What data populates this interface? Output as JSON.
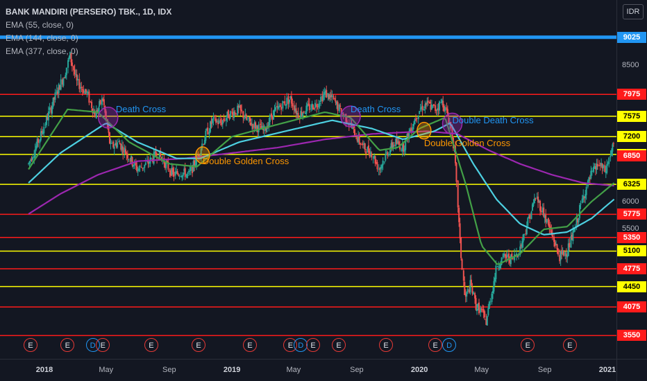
{
  "legend": {
    "title": "BANK MANDIRI (PERSERO) TBK., 1D, IDX",
    "ema": [
      "EMA (55, close, 0)",
      "EMA (144, close, 0)",
      "EMA (377, close, 0)"
    ]
  },
  "currency": "IDR",
  "chart_data": {
    "type": "candlestick",
    "yrange": [
      3450,
      9150
    ],
    "y_ticks": [
      "8500",
      "6000",
      "5500"
    ],
    "x_ticks": [
      {
        "label": "2018",
        "bold": true
      },
      {
        "label": "May",
        "bold": false
      },
      {
        "label": "Sep",
        "bold": false
      },
      {
        "label": "2019",
        "bold": true
      },
      {
        "label": "May",
        "bold": false
      },
      {
        "label": "Sep",
        "bold": false
      },
      {
        "label": "2020",
        "bold": true
      },
      {
        "label": "May",
        "bold": false
      },
      {
        "label": "Sep",
        "bold": false
      },
      {
        "label": "2021",
        "bold": true
      }
    ],
    "horizontal_levels": [
      {
        "label": "9025",
        "value": 9025,
        "color": "#2196f3",
        "text_color": "#ffffff",
        "thick": true
      },
      {
        "label": "7975",
        "value": 7975,
        "color": "#ff1b1b",
        "text_color": "#ffffff"
      },
      {
        "label": "7575",
        "value": 7575,
        "color": "#ffff00",
        "text_color": "#000000"
      },
      {
        "label": "7200",
        "value": 7200,
        "color": "#ffff00",
        "text_color": "#000000"
      },
      {
        "label": "6875",
        "value": 6875,
        "color": "#ffff00",
        "text_color": "#000000"
      },
      {
        "label": "6850",
        "value": 6850,
        "color": "#ff1b1b",
        "text_color": "#ffffff",
        "label_only": true
      },
      {
        "label": "6325",
        "value": 6325,
        "color": "#ffff00",
        "text_color": "#000000"
      },
      {
        "label": "5775",
        "value": 5775,
        "color": "#ff1b1b",
        "text_color": "#ffffff"
      },
      {
        "label": "5350",
        "value": 5350,
        "color": "#ff1b1b",
        "text_color": "#ffffff"
      },
      {
        "label": "5100",
        "value": 5100,
        "color": "#ffff00",
        "text_color": "#000000"
      },
      {
        "label": "4775",
        "value": 4775,
        "color": "#ff1b1b",
        "text_color": "#ffffff"
      },
      {
        "label": "4450",
        "value": 4450,
        "color": "#ffff00",
        "text_color": "#000000"
      },
      {
        "label": "4075",
        "value": 4075,
        "color": "#ff1b1b",
        "text_color": "#ffffff"
      },
      {
        "label": "3550",
        "value": 3550,
        "color": "#ff1b1b",
        "text_color": "#ffffff"
      }
    ],
    "price_path": [
      [
        "2017-12-01",
        6700
      ],
      [
        "2017-12-20",
        7100
      ],
      [
        "2018-01-05",
        7500
      ],
      [
        "2018-01-25",
        8000
      ],
      [
        "2018-02-10",
        8350
      ],
      [
        "2018-02-20",
        8700
      ],
      [
        "2018-03-05",
        8200
      ],
      [
        "2018-03-25",
        8000
      ],
      [
        "2018-04-10",
        7600
      ],
      [
        "2018-04-25",
        7900
      ],
      [
        "2018-05-10",
        7000
      ],
      [
        "2018-05-25",
        7100
      ],
      [
        "2018-06-10",
        6900
      ],
      [
        "2018-07-01",
        6600
      ],
      [
        "2018-07-20",
        6700
      ],
      [
        "2018-08-10",
        6900
      ],
      [
        "2018-08-25",
        6700
      ],
      [
        "2018-09-10",
        6500
      ],
      [
        "2018-09-25",
        6550
      ],
      [
        "2018-10-10",
        6500
      ],
      [
        "2018-10-25",
        6800
      ],
      [
        "2018-11-10",
        7200
      ],
      [
        "2018-11-25",
        7500
      ],
      [
        "2018-12-10",
        7450
      ],
      [
        "2018-12-25",
        7600
      ],
      [
        "2019-01-15",
        7700
      ],
      [
        "2019-01-30",
        7500
      ],
      [
        "2019-02-15",
        7400
      ],
      [
        "2019-03-05",
        7300
      ],
      [
        "2019-03-20",
        7600
      ],
      [
        "2019-04-10",
        7800
      ],
      [
        "2019-04-25",
        7900
      ],
      [
        "2019-05-10",
        7600
      ],
      [
        "2019-05-25",
        7700
      ],
      [
        "2019-06-15",
        7800
      ],
      [
        "2019-07-01",
        8000
      ],
      [
        "2019-07-15",
        7900
      ],
      [
        "2019-07-30",
        7700
      ],
      [
        "2019-08-15",
        7500
      ],
      [
        "2019-09-01",
        7200
      ],
      [
        "2019-09-15",
        7000
      ],
      [
        "2019-10-01",
        6900
      ],
      [
        "2019-10-15",
        6600
      ],
      [
        "2019-10-30",
        6900
      ],
      [
        "2019-11-15",
        7100
      ],
      [
        "2019-12-01",
        7000
      ],
      [
        "2019-12-15",
        7350
      ],
      [
        "2020-01-01",
        7700
      ],
      [
        "2020-01-15",
        7800
      ],
      [
        "2020-02-01",
        7700
      ],
      [
        "2020-02-15",
        7850
      ],
      [
        "2020-03-01",
        7450
      ],
      [
        "2020-03-10",
        6900
      ],
      [
        "2020-03-20",
        5300
      ],
      [
        "2020-03-30",
        4200
      ],
      [
        "2020-04-10",
        4500
      ],
      [
        "2020-04-20",
        4100
      ],
      [
        "2020-05-01",
        4000
      ],
      [
        "2020-05-10",
        3800
      ],
      [
        "2020-05-20",
        4300
      ],
      [
        "2020-06-01",
        4850
      ],
      [
        "2020-06-15",
        5000
      ],
      [
        "2020-07-01",
        4950
      ],
      [
        "2020-07-15",
        5150
      ],
      [
        "2020-08-01",
        5700
      ],
      [
        "2020-08-15",
        6100
      ],
      [
        "2020-08-30",
        5800
      ],
      [
        "2020-09-15",
        5400
      ],
      [
        "2020-09-30",
        5000
      ],
      [
        "2020-10-15",
        5100
      ],
      [
        "2020-10-30",
        5500
      ],
      [
        "2020-11-15",
        6100
      ],
      [
        "2020-12-01",
        6500
      ],
      [
        "2020-12-15",
        6700
      ],
      [
        "2020-12-28",
        6550
      ],
      [
        "2021-01-08",
        6900
      ],
      [
        "2021-01-14",
        7050
      ]
    ],
    "ema55": [
      [
        "2017-12-01",
        6600
      ],
      [
        "2018-02-15",
        7700
      ],
      [
        "2018-04-15",
        7650
      ],
      [
        "2018-06-15",
        7100
      ],
      [
        "2018-09-01",
        6700
      ],
      [
        "2018-10-25",
        6650
      ],
      [
        "2019-01-01",
        7200
      ],
      [
        "2019-03-01",
        7350
      ],
      [
        "2019-05-01",
        7500
      ],
      [
        "2019-07-01",
        7650
      ],
      [
        "2019-08-20",
        7550
      ],
      [
        "2019-10-15",
        6950
      ],
      [
        "2019-11-20",
        7000
      ],
      [
        "2020-01-01",
        7350
      ],
      [
        "2020-02-20",
        7550
      ],
      [
        "2020-04-01",
        6300
      ],
      [
        "2020-05-01",
        5200
      ],
      [
        "2020-06-01",
        4850
      ],
      [
        "2020-07-15",
        5050
      ],
      [
        "2020-08-30",
        5500
      ],
      [
        "2020-10-15",
        5550
      ],
      [
        "2020-11-30",
        6000
      ],
      [
        "2021-01-14",
        6350
      ]
    ],
    "ema144": [
      [
        "2017-12-01",
        6350
      ],
      [
        "2018-02-01",
        6900
      ],
      [
        "2018-05-01",
        7450
      ],
      [
        "2018-07-01",
        7100
      ],
      [
        "2018-09-15",
        6800
      ],
      [
        "2018-11-01",
        6800
      ],
      [
        "2019-01-15",
        7100
      ],
      [
        "2019-04-15",
        7300
      ],
      [
        "2019-07-15",
        7500
      ],
      [
        "2019-09-30",
        7350
      ],
      [
        "2019-11-30",
        7150
      ],
      [
        "2020-01-30",
        7300
      ],
      [
        "2020-03-01",
        7450
      ],
      [
        "2020-04-15",
        6700
      ],
      [
        "2020-05-30",
        6050
      ],
      [
        "2020-07-15",
        5600
      ],
      [
        "2020-08-30",
        5400
      ],
      [
        "2020-10-15",
        5450
      ],
      [
        "2020-12-01",
        5700
      ],
      [
        "2021-01-14",
        6050
      ]
    ],
    "ema377": [
      [
        "2017-12-01",
        5780
      ],
      [
        "2018-02-01",
        6150
      ],
      [
        "2018-04-15",
        6500
      ],
      [
        "2018-07-01",
        6750
      ],
      [
        "2018-10-01",
        6800
      ],
      [
        "2019-01-01",
        6900
      ],
      [
        "2019-04-01",
        7000
      ],
      [
        "2019-07-01",
        7150
      ],
      [
        "2019-10-01",
        7250
      ],
      [
        "2020-01-15",
        7300
      ],
      [
        "2020-03-15",
        7250
      ],
      [
        "2020-05-15",
        6950
      ],
      [
        "2020-07-15",
        6700
      ],
      [
        "2020-09-15",
        6500
      ],
      [
        "2020-11-15",
        6350
      ],
      [
        "2021-01-14",
        6300
      ]
    ],
    "annotations": [
      {
        "text": "Death Cross",
        "color": "#2196f3",
        "date": "2018-05-20",
        "value": 7700,
        "circle_date": "2018-05-05",
        "circle_value": 7550,
        "circle_color": "#9c27b0"
      },
      {
        "text": "Double Golden Cross",
        "color": "#ff9800",
        "date": "2018-11-05",
        "value": 6750,
        "circle_date": "2018-11-05",
        "circle_value": 6860,
        "circle_color": "#ff9800"
      },
      {
        "text": "Death Cross",
        "color": "#2196f3",
        "date": "2019-08-20",
        "value": 7700,
        "circle_date": "2019-08-20",
        "circle_value": 7570,
        "circle_color": "#9c27b0"
      },
      {
        "text": "Double Golden Cross",
        "color": "#ff9800",
        "date": "2020-01-10",
        "value": 7070,
        "circle_date": "2020-01-10",
        "circle_value": 7310,
        "circle_color": "#ff9800"
      },
      {
        "text": "Double Death Cross",
        "color": "#2196f3",
        "date": "2020-03-05",
        "value": 7500,
        "circle_date": "2020-03-05",
        "circle_value": 7440,
        "circle_color": "#9c27b0"
      }
    ],
    "events": [
      {
        "label": "E",
        "type": "earnings",
        "date": "2017-12-05"
      },
      {
        "label": "E",
        "type": "earnings",
        "date": "2018-02-15"
      },
      {
        "label": "D",
        "type": "dividend",
        "date": "2018-04-05"
      },
      {
        "label": "E",
        "type": "earnings",
        "date": "2018-04-25"
      },
      {
        "label": "E",
        "type": "earnings",
        "date": "2018-07-28"
      },
      {
        "label": "E",
        "type": "earnings",
        "date": "2018-10-28"
      },
      {
        "label": "E",
        "type": "earnings",
        "date": "2019-02-05"
      },
      {
        "label": "E",
        "type": "earnings",
        "date": "2019-04-25"
      },
      {
        "label": "D",
        "type": "dividend",
        "date": "2019-05-15"
      },
      {
        "label": "E",
        "type": "earnings",
        "date": "2019-06-08"
      },
      {
        "label": "E",
        "type": "earnings",
        "date": "2019-07-28"
      },
      {
        "label": "E",
        "type": "earnings",
        "date": "2019-10-28"
      },
      {
        "label": "E",
        "type": "earnings",
        "date": "2020-02-01"
      },
      {
        "label": "D",
        "type": "dividend",
        "date": "2020-02-28"
      },
      {
        "label": "E",
        "type": "earnings",
        "date": "2020-07-30"
      },
      {
        "label": "E",
        "type": "earnings",
        "date": "2020-10-20"
      }
    ],
    "colors": {
      "up": "#26a69a",
      "down": "#ef5350",
      "ema55": "#43a047",
      "ema144": "#4dd0e1",
      "ema377": "#9c27b0",
      "background": "#131722"
    }
  }
}
